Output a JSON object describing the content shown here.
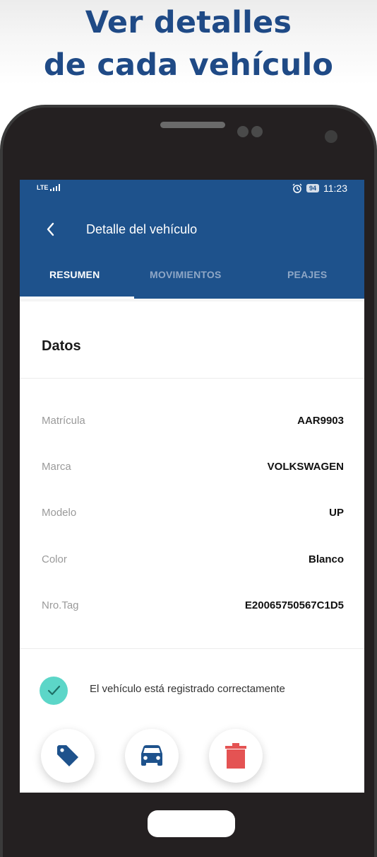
{
  "headline": {
    "line1": "Ver detalles",
    "line2": "de cada vehículo"
  },
  "status_bar": {
    "network": "LTE",
    "battery": "94",
    "time": "11:23"
  },
  "app_bar": {
    "title": "Detalle del vehículo"
  },
  "tabs": [
    {
      "label": "RESUMEN",
      "active": true
    },
    {
      "label": "MOVIMIENTOS",
      "active": false
    },
    {
      "label": "PEAJES",
      "active": false
    }
  ],
  "section": {
    "title": "Datos"
  },
  "details": [
    {
      "label": "Matrícula",
      "value": "AAR9903"
    },
    {
      "label": "Marca",
      "value": "VOLKSWAGEN"
    },
    {
      "label": "Modelo",
      "value": "UP"
    },
    {
      "label": "Color",
      "value": "Blanco"
    },
    {
      "label": "Nro.Tag",
      "value": "E20065750567C1D5"
    }
  ],
  "status_message": "El vehículo está registrado correctamente",
  "actions": [
    {
      "icon": "tag-icon"
    },
    {
      "icon": "car-icon"
    },
    {
      "icon": "trash-icon"
    }
  ],
  "colors": {
    "headline": "#1f4a86",
    "app_bar": "#1e528c",
    "success": "#5cd6c8",
    "action_tag": "#1e528c",
    "action_car": "#1e528c",
    "action_delete": "#e45353"
  }
}
